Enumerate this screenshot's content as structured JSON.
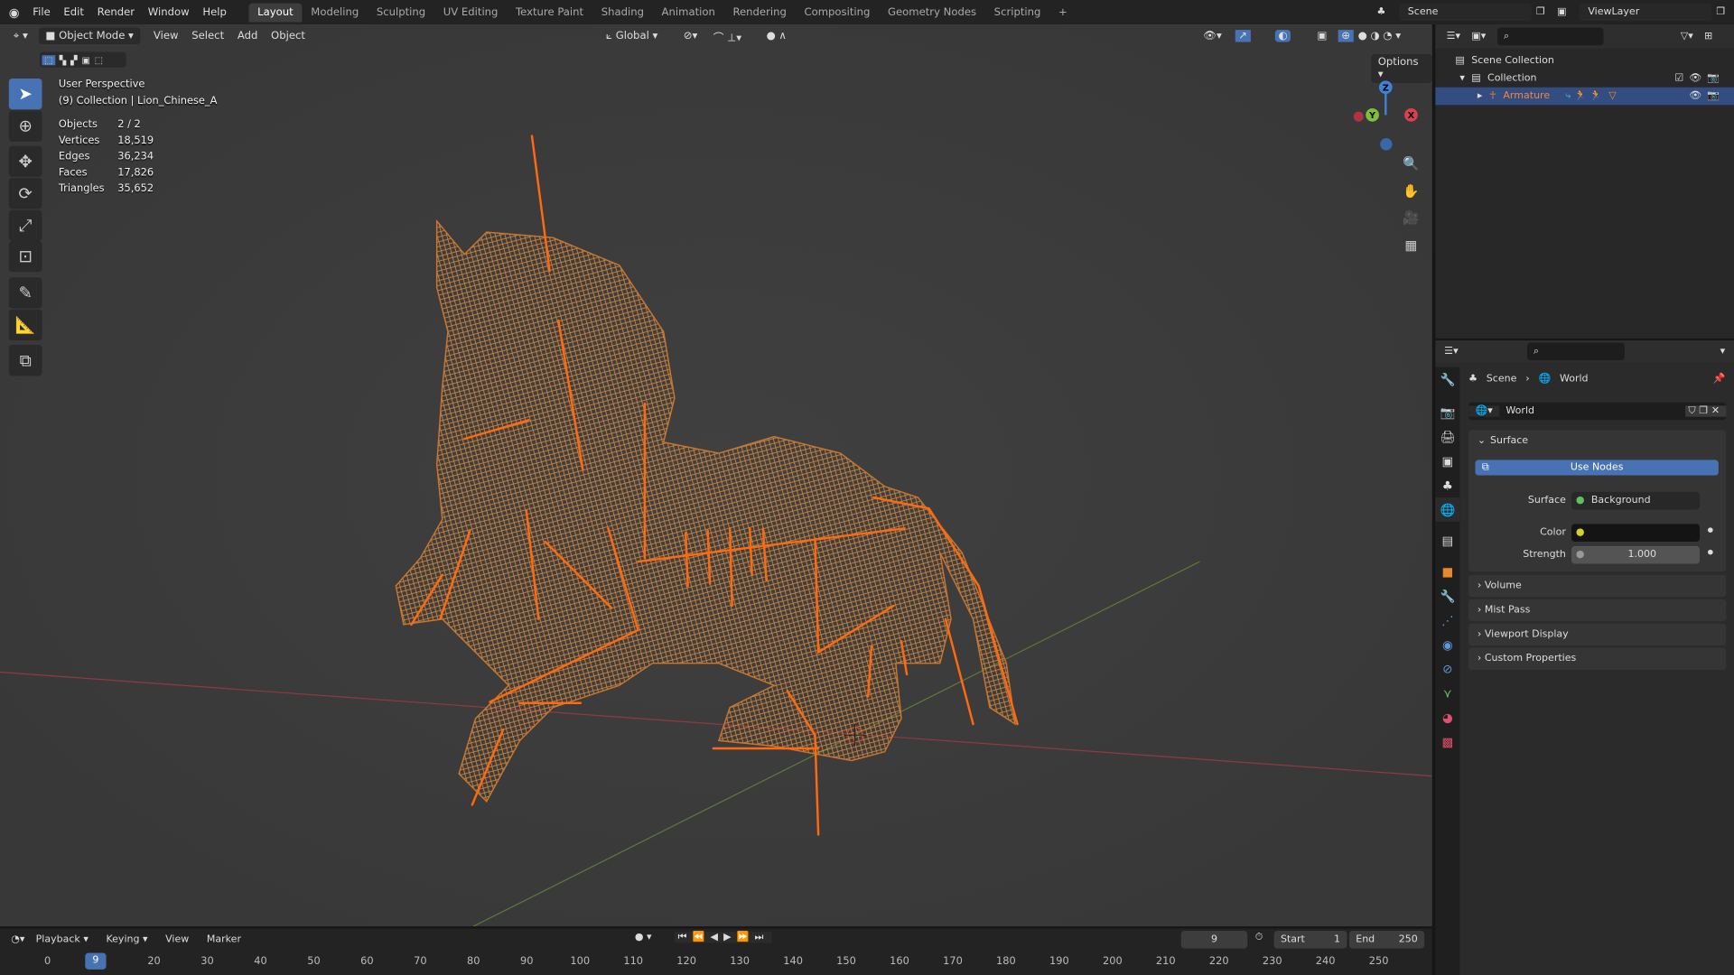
{
  "topbar": {
    "menus": [
      "File",
      "Edit",
      "Render",
      "Window",
      "Help"
    ],
    "workspaces": [
      "Layout",
      "Modeling",
      "Sculpting",
      "UV Editing",
      "Texture Paint",
      "Shading",
      "Animation",
      "Rendering",
      "Compositing",
      "Geometry Nodes",
      "Scripting"
    ],
    "active_workspace": "Layout",
    "add_tab": "+",
    "scene": "Scene",
    "view_layer": "ViewLayer"
  },
  "viewport_header": {
    "mode": "Object Mode",
    "menus": [
      "View",
      "Select",
      "Add",
      "Object"
    ],
    "orientation": "Global",
    "options": "Options"
  },
  "overlay": {
    "view_name": "User Perspective",
    "context": "(9) Collection | Lion_Chinese_A",
    "stats": [
      {
        "label": "Objects",
        "value": "2 / 2"
      },
      {
        "label": "Vertices",
        "value": "18,519"
      },
      {
        "label": "Edges",
        "value": "36,234"
      },
      {
        "label": "Faces",
        "value": "17,826"
      },
      {
        "label": "Triangles",
        "value": "35,652"
      }
    ]
  },
  "gizmo": {
    "z": "Z",
    "y": "Y",
    "x": "X"
  },
  "outliner": {
    "scene_collection": "Scene Collection",
    "collection": "Collection",
    "armature": "Armature"
  },
  "properties": {
    "breadcrumb_scene": "Scene",
    "breadcrumb_world": "World",
    "world_name": "World",
    "surface_header": "Surface",
    "use_nodes": "Use Nodes",
    "surface_label": "Surface",
    "surface_value": "Background",
    "color_label": "Color",
    "strength_label": "Strength",
    "strength_value": "1.000",
    "collapsed": [
      "Volume",
      "Mist Pass",
      "Viewport Display",
      "Custom Properties"
    ]
  },
  "timeline": {
    "menus": [
      "Playback",
      "Keying",
      "View",
      "Marker"
    ],
    "current_frame": "9",
    "start_label": "Start",
    "start": "1",
    "end_label": "End",
    "end": "250",
    "ticks": [
      "0",
      "20",
      "30",
      "40",
      "50",
      "60",
      "70",
      "80",
      "90",
      "100",
      "110",
      "120",
      "130",
      "140",
      "150",
      "160",
      "170",
      "180",
      "190",
      "200",
      "210",
      "220",
      "230",
      "240",
      "250"
    ]
  },
  "colors": {
    "accent": "#4772b3",
    "wire": "#e08a3c",
    "bone": "#ff6a10",
    "x_axis": "#9b3b4a",
    "y_axis": "#6b8a3a"
  }
}
